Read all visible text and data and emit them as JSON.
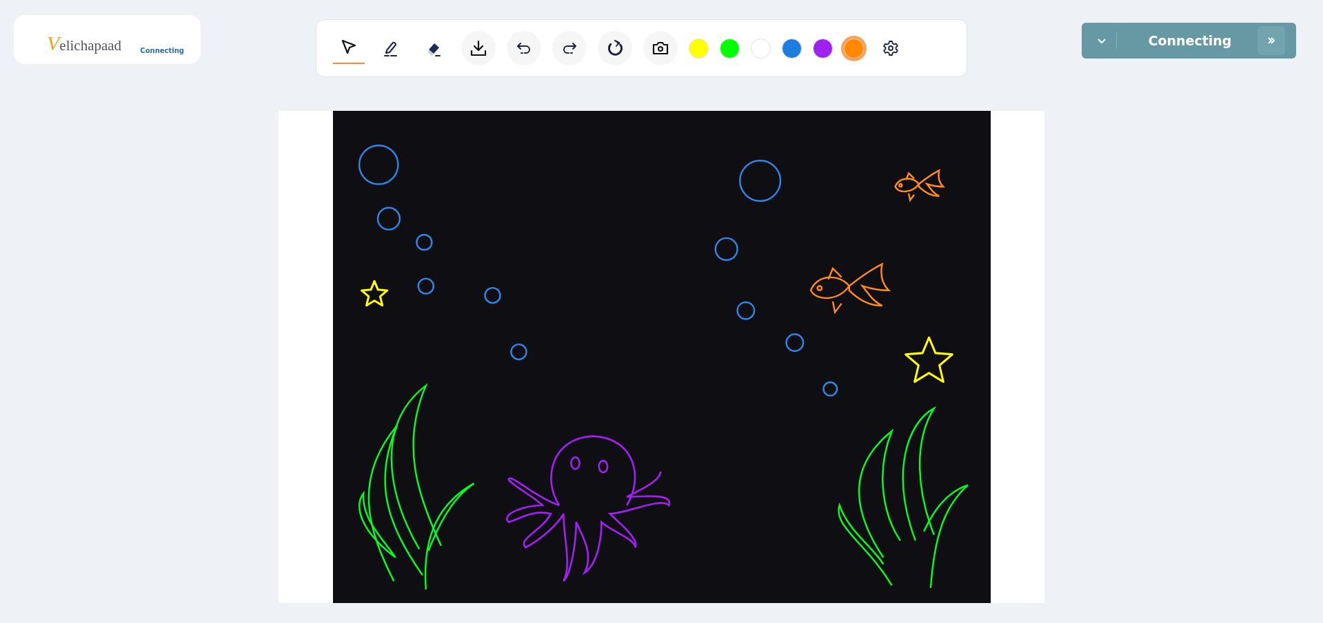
{
  "logo": {
    "initial": "V",
    "rest": "elichapaad",
    "status": "Connecting"
  },
  "toolbar": {
    "tools": [
      {
        "kind": "select",
        "selected": true
      },
      {
        "kind": "pen",
        "selected": false
      },
      {
        "kind": "eraser",
        "selected": false
      }
    ],
    "actions": [
      {
        "kind": "download"
      },
      {
        "kind": "undo"
      },
      {
        "kind": "redo"
      },
      {
        "kind": "reset"
      },
      {
        "kind": "camera"
      }
    ],
    "colors": [
      {
        "color": "#ffff00",
        "selected": false
      },
      {
        "color": "#00ff00",
        "selected": false
      },
      {
        "color": "#ffffff",
        "selected": false
      },
      {
        "color": "#1e7be0",
        "selected": false
      },
      {
        "color": "#a020f0",
        "selected": false
      },
      {
        "color": "#ff8800",
        "selected": true
      }
    ]
  },
  "connection": {
    "label": "Connecting"
  }
}
